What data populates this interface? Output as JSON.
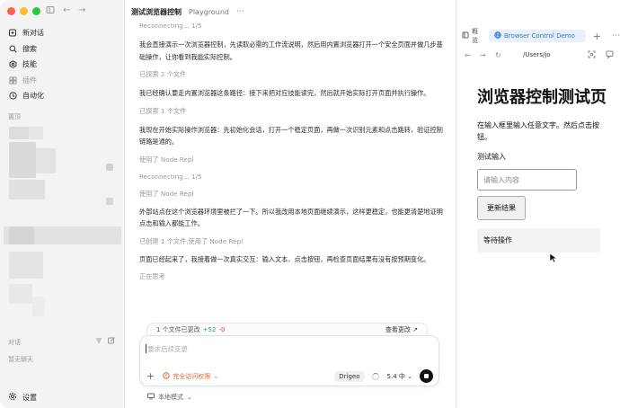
{
  "sidebar": {
    "nav": [
      {
        "label": "新对话",
        "icon": "new-chat-icon"
      },
      {
        "label": "搜索",
        "icon": "search-icon"
      },
      {
        "label": "技能",
        "icon": "skills-icon"
      },
      {
        "label": "插件",
        "icon": "plugin-icon"
      },
      {
        "label": "自动化",
        "icon": "clock-icon"
      }
    ],
    "pinned_title": "置顶",
    "chats_title": "对话",
    "no_chats": "暂无聊天",
    "settings": "设置"
  },
  "main": {
    "thread_title": "测试浏览器控制",
    "project": "Playground",
    "messages": [
      {
        "type": "meta",
        "text": "Reconnecting... 1/5"
      },
      {
        "type": "para",
        "text": "我会直接演示一次浏览器控制，先读取必需的工作流说明，然后用内置浏览器打开一个安全页面并做几步基础操作，让你看到我能实际控制。"
      },
      {
        "type": "meta",
        "text": "已探索 2 个文件"
      },
      {
        "type": "para",
        "text": "我已经确认要走内置浏览器这条路径：接下来把对应技能读完，然后就开始实际打开页面并执行操作。"
      },
      {
        "type": "meta",
        "text": "已探索 1 个文件"
      },
      {
        "type": "para",
        "text": "我现在开始实际操作浏览器：先初始化会话，打开一个稳定页面，再做一次识别元素和点击跳转，验证控制链路是通的。"
      },
      {
        "type": "meta",
        "text": "使用了 Node Repl"
      },
      {
        "type": "meta",
        "text": "Reconnecting... 1/5"
      },
      {
        "type": "meta",
        "text": "使用了 Node Repl"
      },
      {
        "type": "para",
        "text": "外部站点在这个浏览器环境里被拦了一下。所以我改用本地页面继续演示，这样更稳定，也能更清楚地证明点击和输入都能工作。"
      },
      {
        "type": "meta",
        "text": "已创建 1 个文件,使用了 Node Repl"
      },
      {
        "type": "para",
        "text": "页面已经起来了，我接着做一次真实交互：输入文本、点击按钮，再检查页面结果有没有按预期变化。"
      },
      {
        "type": "meta",
        "text": "正在思考"
      }
    ],
    "changes": {
      "summary": "1 个文件已更改",
      "added": "+52",
      "removed": "-0",
      "view": "查看更改"
    },
    "composer": {
      "placeholder": "要求后续变更",
      "permission": "完全访问权限",
      "model": "Drigeo",
      "version": "5.4",
      "effort": "中"
    },
    "local_mode": "本地模式"
  },
  "panel": {
    "tab_overview": "概览",
    "tab_browser": "Browser Control Demo",
    "url": "/Users/jo",
    "page": {
      "heading": "浏览器控制测试页",
      "description": "在输入框里输入任意文字。然后点击按钮。",
      "input_label": "测试输入",
      "input_placeholder": "请输入内容",
      "button": "更新结果",
      "status": "等待操作"
    }
  },
  "colors": {
    "accent_blue": "#3478c6",
    "added_green": "#2e9d4a",
    "removed_red": "#d93838",
    "permission_orange": "#e0672c"
  }
}
